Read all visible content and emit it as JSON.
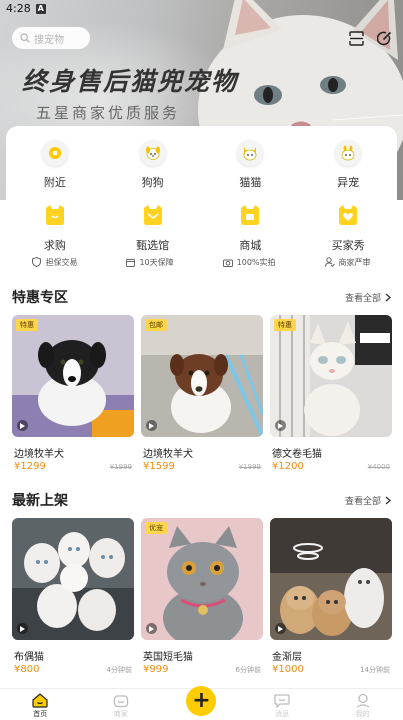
{
  "status_bar": {
    "time": "4:28",
    "mark": "A"
  },
  "search": {
    "placeholder": "搜宠物",
    "icon": "search-icon"
  },
  "header_icons": [
    "scan-icon",
    "edit-icon"
  ],
  "banner": {
    "slogan": "终身售后猫兜宠物",
    "subslogan": "五星商家优质服务"
  },
  "categories_row1": [
    {
      "label": "附近",
      "icon": "location-pin-icon"
    },
    {
      "label": "狗狗",
      "icon": "dog-icon"
    },
    {
      "label": "猫猫",
      "icon": "cat-icon"
    },
    {
      "label": "异宠",
      "icon": "exotic-pet-icon"
    }
  ],
  "categories_row2": [
    {
      "label": "求购",
      "icon": "want-to-buy-icon"
    },
    {
      "label": "甄选馆",
      "icon": "selection-hall-icon"
    },
    {
      "label": "商城",
      "icon": "mall-icon"
    },
    {
      "label": "买家秀",
      "icon": "buyer-show-icon"
    }
  ],
  "guarantees": [
    {
      "label": "担保交易",
      "icon": "shield-icon"
    },
    {
      "label": "10天保障",
      "icon": "calendar-icon"
    },
    {
      "label": "100%实拍",
      "icon": "camera-icon"
    },
    {
      "label": "商家严审",
      "icon": "person-check-icon"
    }
  ],
  "special": {
    "title": "特惠专区",
    "see_all": "查看全部",
    "items": [
      {
        "tag": "特惠",
        "name": "边境牧羊犬",
        "price": "¥1299",
        "original": "¥1999",
        "color": "#2f2f2f"
      },
      {
        "tag": "包邮",
        "name": "边境牧羊犬",
        "price": "¥1599",
        "original": "¥1999",
        "color": "#6b3b24"
      },
      {
        "tag": "特惠",
        "name": "德文卷毛猫",
        "price": "¥1200",
        "original": "¥4000",
        "color": "#f2ede8"
      }
    ]
  },
  "new_arrivals": {
    "title": "最新上架",
    "see_all": "查看全部",
    "items": [
      {
        "tag": "",
        "name": "布偶猫",
        "price": "¥800",
        "ago": "4分钟前"
      },
      {
        "tag": "优宠",
        "name": "英国短毛猫",
        "price": "¥999",
        "ago": "6分钟前"
      },
      {
        "tag": "",
        "name": "金渐层",
        "price": "¥1000",
        "ago": "14分钟前"
      }
    ]
  },
  "bottom_nav": [
    {
      "label": "首页",
      "icon": "home-icon",
      "active": true
    },
    {
      "label": "商家",
      "icon": "store-icon",
      "active": false
    },
    {
      "label": "",
      "icon": "plus-icon",
      "active": false
    },
    {
      "label": "消息",
      "icon": "message-icon",
      "active": false
    },
    {
      "label": "我的",
      "icon": "profile-icon",
      "active": false
    }
  ],
  "colors": {
    "accent": "#ffcc00",
    "price": "#f28b0c",
    "tag": "#ffd54a"
  }
}
